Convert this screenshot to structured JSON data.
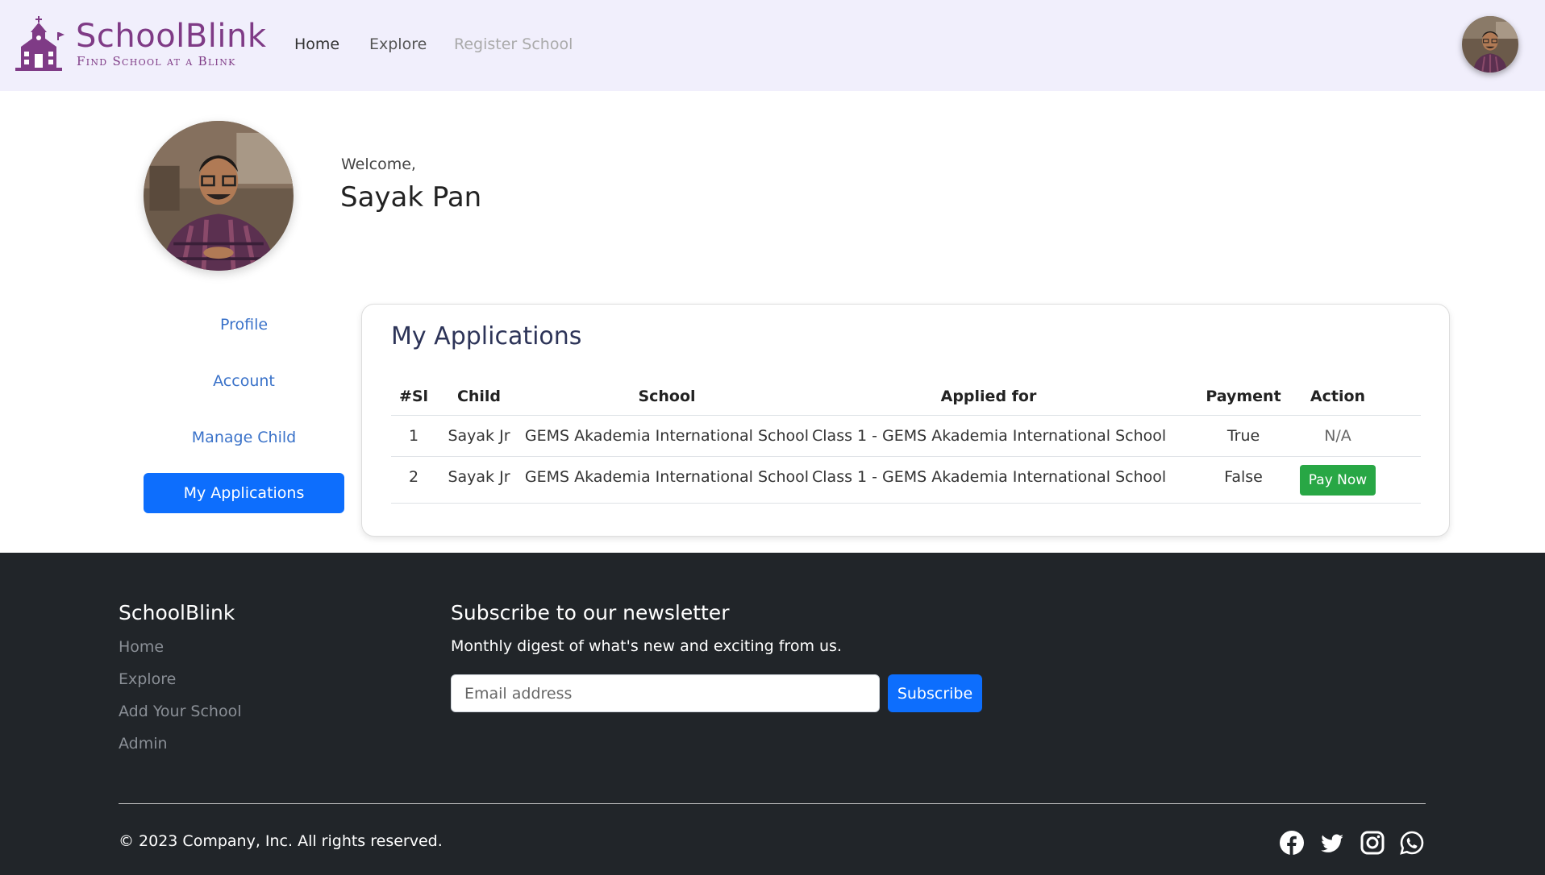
{
  "header": {
    "logo_title": "SchoolBlink",
    "logo_tagline": "Find School at a Blink",
    "nav": {
      "home": "Home",
      "explore": "Explore",
      "register": "Register School"
    },
    "brand_color": "#7f3b86",
    "background": "#f1effc"
  },
  "profile": {
    "welcome": "Welcome,",
    "name": "Sayak Pan"
  },
  "sidebar": {
    "items": [
      {
        "label": "Profile"
      },
      {
        "label": "Account"
      },
      {
        "label": "Manage Child"
      },
      {
        "label": "My Applications",
        "active": true
      }
    ]
  },
  "applications": {
    "title": "My Applications",
    "columns": [
      "#Sl",
      "Child",
      "School",
      "Applied for",
      "Payment",
      "Action"
    ],
    "rows": [
      {
        "sl": "1",
        "child": "Sayak Jr",
        "school": "GEMS Akademia International School",
        "applied_for": "Class 1 - GEMS Akademia International School",
        "payment": "True",
        "action": "N/A"
      },
      {
        "sl": "2",
        "child": "Sayak Jr",
        "school": "GEMS Akademia International School",
        "applied_for": "Class 1 - GEMS Akademia International School",
        "payment": "False",
        "action": "Pay Now"
      }
    ]
  },
  "footer": {
    "brand": "SchoolBlink",
    "links": [
      "Home",
      "Explore",
      "Add Your School",
      "Admin"
    ],
    "newsletter": {
      "title": "Subscribe to our newsletter",
      "description": "Monthly digest of what's new and exciting from us.",
      "email_placeholder": "Email address",
      "subscribe_label": "Subscribe"
    },
    "copyright": "© 2023 Company, Inc. All rights reserved.",
    "social_icons": [
      "facebook-icon",
      "twitter-icon",
      "instagram-icon",
      "whatsapp-icon"
    ],
    "background": "#212529"
  },
  "colors": {
    "primary": "#0d6efd",
    "success": "#28a745",
    "link": "#3a72c9"
  }
}
